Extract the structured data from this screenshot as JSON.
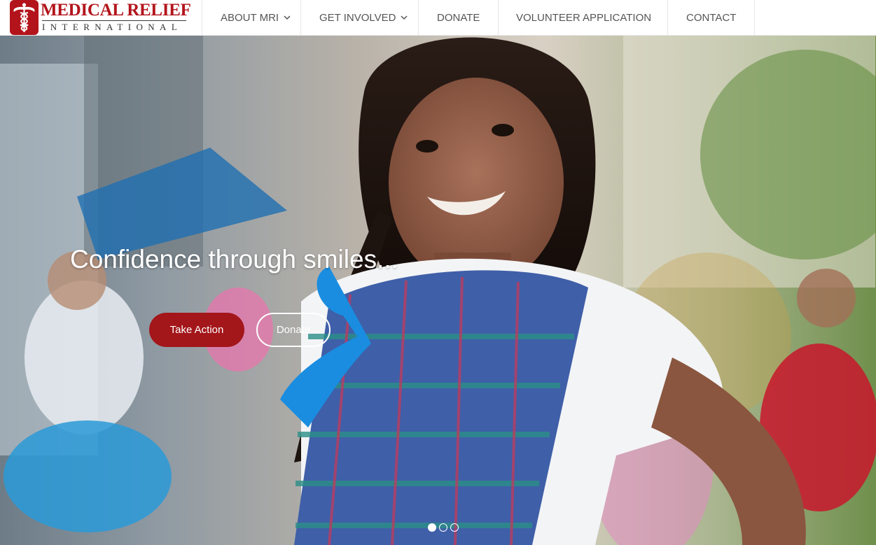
{
  "brand": {
    "name": "MEDICAL RELIEF",
    "subtitle": "INTERNATIONAL",
    "logo_icon": "caduceus-icon",
    "brand_color": "#b3141b"
  },
  "nav": {
    "items": [
      {
        "label": "ABOUT MRI",
        "has_dropdown": true
      },
      {
        "label": "GET INVOLVED",
        "has_dropdown": true
      },
      {
        "label": "DONATE",
        "has_dropdown": false
      },
      {
        "label": "VOLUNTEER APPLICATION",
        "has_dropdown": false
      },
      {
        "label": "CONTACT",
        "has_dropdown": false
      }
    ],
    "dropdown_icon": "chevron-down-icon"
  },
  "hero": {
    "caption": "Confidence through smiles...",
    "primary_button": "Take Action",
    "secondary_button": "Donate",
    "primary_color": "#a3161a",
    "slides_total": 3,
    "active_slide": 1
  }
}
